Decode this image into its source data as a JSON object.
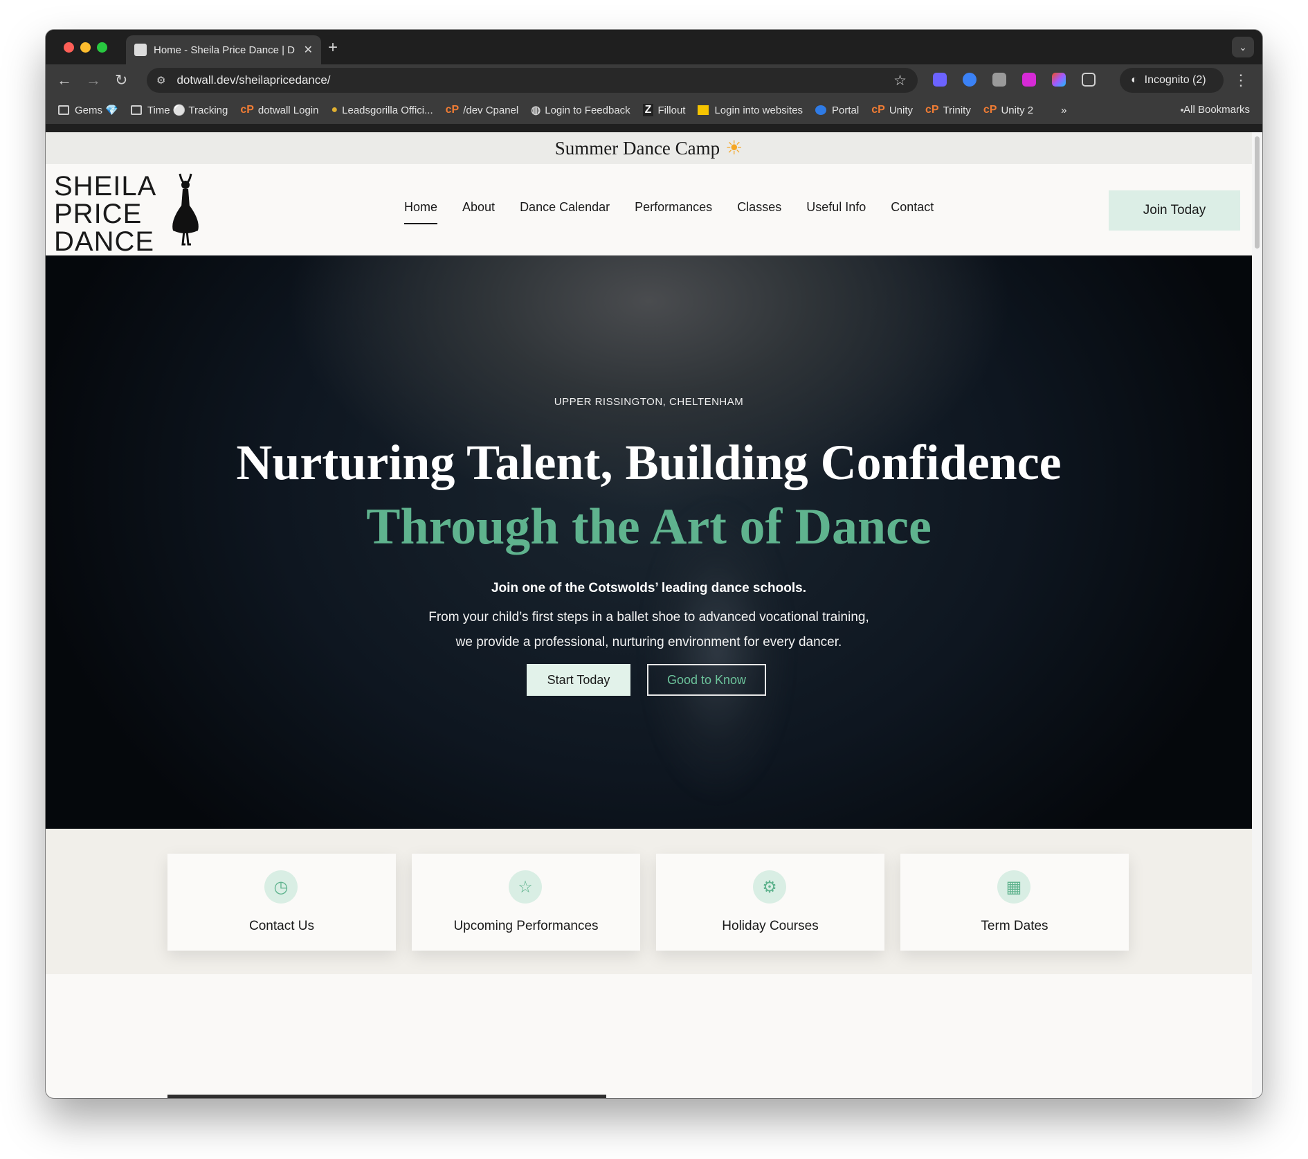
{
  "browser": {
    "tab_title": "Home - Sheila Price Dance | D",
    "url": "dotwall.dev/sheilapricedance/",
    "incognito_label": "Incognito (2)",
    "bookmarks": [
      {
        "label": "Gems 💎",
        "icon": "folder-icon"
      },
      {
        "label": "Time ⚪ Tracking",
        "icon": "folder-icon"
      },
      {
        "label": "dotwall Login",
        "icon": "cpanel-icon"
      },
      {
        "label": "Leadsgorilla Offici...",
        "icon": "gorilla-icon"
      },
      {
        "label": "/dev Cpanel",
        "icon": "cpanel-icon"
      },
      {
        "label": "Login to Feedback",
        "icon": "globe-icon"
      },
      {
        "label": "Fillout",
        "icon": "fillout-icon"
      },
      {
        "label": "Login into websites",
        "icon": "yellow-square-icon"
      },
      {
        "label": "Portal",
        "icon": "portal-icon"
      },
      {
        "label": "Unity",
        "icon": "cpanel-icon"
      },
      {
        "label": "Trinity",
        "icon": "cpanel-icon"
      },
      {
        "label": "Unity 2",
        "icon": "cpanel-icon"
      }
    ],
    "all_bookmarks_label": "All Bookmarks"
  },
  "announcement": {
    "text": "Summer Dance Camp",
    "emoji": "☀"
  },
  "logo": {
    "line1": "SHEILA",
    "line2": "PRICE",
    "line3": "DANCE"
  },
  "nav": {
    "items": [
      "Home",
      "About",
      "Dance Calendar",
      "Performances",
      "Classes",
      "Useful Info",
      "Contact"
    ],
    "active": "Home",
    "cta": "Join Today"
  },
  "hero": {
    "eyebrow": "UPPER RISSINGTON, CHELTENHAM",
    "title_line1": "Nurturing Talent, Building Confidence",
    "title_line2": "Through the Art of Dance",
    "lead": "Join one of the Cotswolds’ leading dance schools.",
    "body": "From your child’s first steps in a ballet shoe to advanced vocational training, we provide a professional, nurturing environment for every dancer.",
    "primary_button": "Start Today",
    "secondary_button": "Good to Know"
  },
  "cards": [
    {
      "label": "Contact Us",
      "icon": "clock-icon"
    },
    {
      "label": "Upcoming Performances",
      "icon": "star-icon"
    },
    {
      "label": "Holiday Courses",
      "icon": "gear-icon"
    },
    {
      "label": "Term Dates",
      "icon": "calendar-icon"
    }
  ],
  "colors": {
    "accent": "#5fb38e",
    "accent_light": "#dceee6",
    "page_bg": "#faf9f7"
  }
}
